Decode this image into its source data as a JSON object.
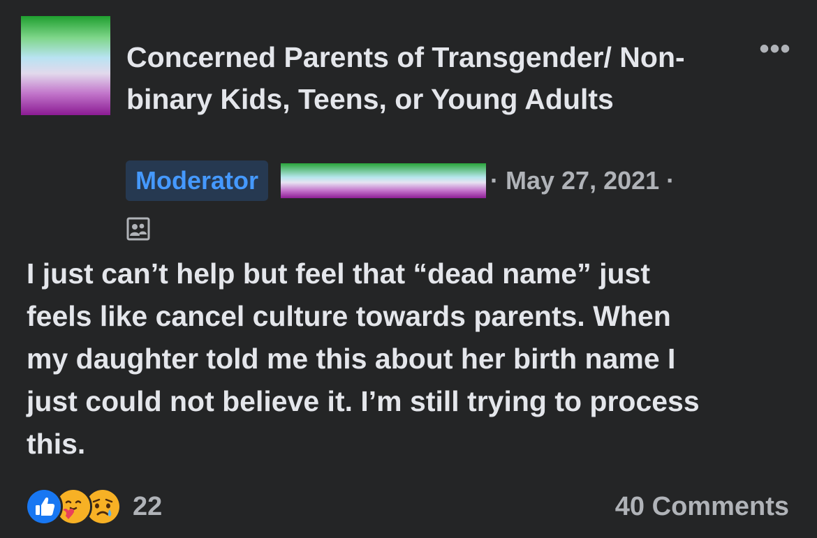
{
  "post": {
    "group_name": "Concerned Parents of Transgender/ Non-binary Kids, Teens, or Young Adults",
    "author_badge": "Moderator",
    "date_text": "· May 27, 2021 ·",
    "audience_icon": "group-audience-icon",
    "more_icon": "more-options-icon",
    "more_label": "•••",
    "body": "I just can’t help but feel that “dead name” just\nfeels like cancel culture towards parents. When\nmy daughter told me this about her birth name I\njust could not believe it. I’m still trying to process\nthis."
  },
  "footer": {
    "reactions": [
      "like",
      "care",
      "sad"
    ],
    "reaction_count": "22",
    "comments_label": "40 Comments"
  },
  "colors": {
    "background": "#242526",
    "text_primary": "#e4e6eb",
    "text_secondary": "#b0b3b8",
    "badge_bg": "#263951",
    "badge_text": "#4599ff",
    "like_blue": "#1877f2"
  }
}
